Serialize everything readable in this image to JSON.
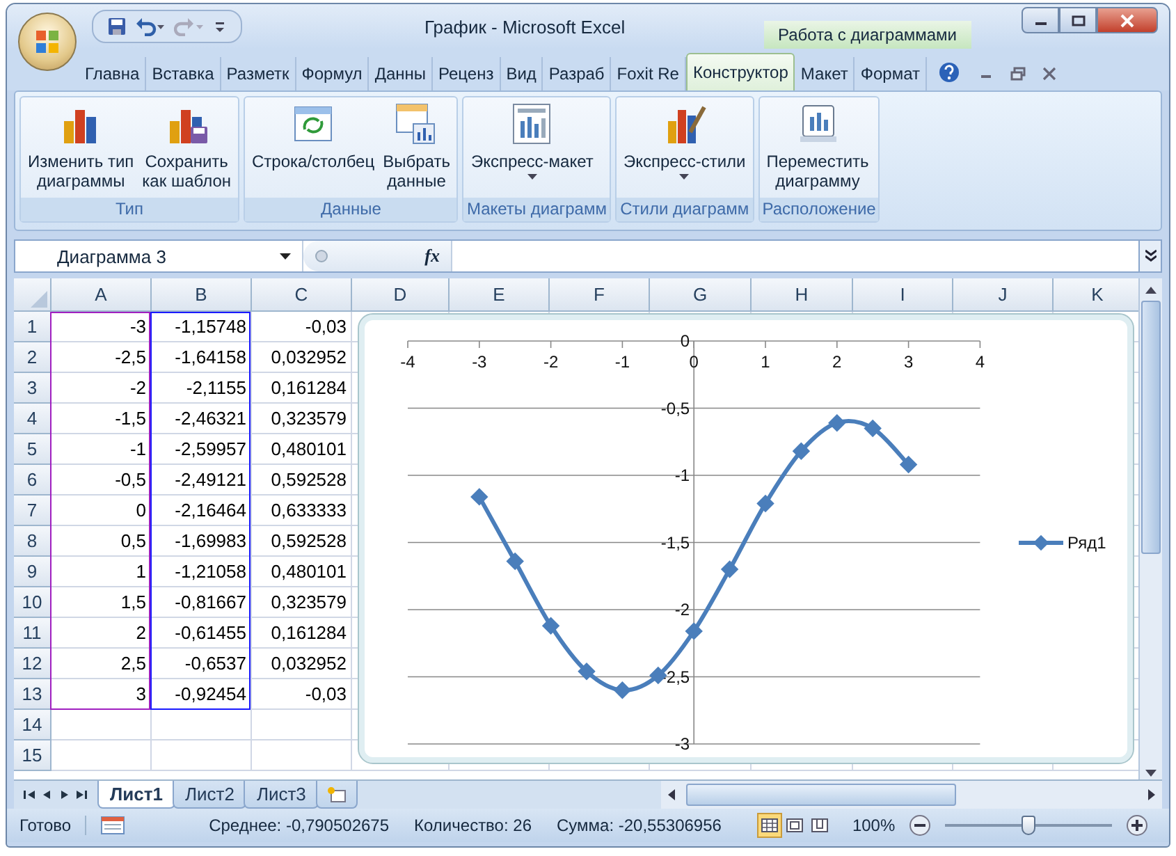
{
  "window": {
    "title": "График - Microsoft Excel",
    "context_title": "Работа с диаграммами"
  },
  "ribbon_tabs": [
    {
      "label": "Главна",
      "selected": false
    },
    {
      "label": "Вставка",
      "selected": false
    },
    {
      "label": "Разметк",
      "selected": false
    },
    {
      "label": "Формул",
      "selected": false
    },
    {
      "label": "Данны",
      "selected": false
    },
    {
      "label": "Реценз",
      "selected": false
    },
    {
      "label": "Вид",
      "selected": false
    },
    {
      "label": "Разраб",
      "selected": false
    },
    {
      "label": "Foxit Re",
      "selected": false
    },
    {
      "label": "Конструктор",
      "selected": true
    },
    {
      "label": "Макет",
      "selected": false
    },
    {
      "label": "Формат",
      "selected": false
    }
  ],
  "ribbon_groups": [
    {
      "label": "Тип",
      "buttons": [
        {
          "label": "Изменить тип\nдиаграммы",
          "kind": "change-type"
        },
        {
          "label": "Сохранить\nкак шаблон",
          "kind": "save-template"
        }
      ]
    },
    {
      "label": "Данные",
      "buttons": [
        {
          "label": "Строка/столбец",
          "kind": "switch"
        },
        {
          "label": "Выбрать\nданные",
          "kind": "select-data"
        }
      ]
    },
    {
      "label": "Макеты диаграмм",
      "buttons": [
        {
          "label": "Экспресс-макет",
          "kind": "layout",
          "dropdown": true
        }
      ]
    },
    {
      "label": "Стили диаграмм",
      "buttons": [
        {
          "label": "Экспресс-стили",
          "kind": "styles",
          "dropdown": true
        }
      ]
    },
    {
      "label": "Расположение",
      "buttons": [
        {
          "label": "Переместить\nдиаграмму",
          "kind": "move"
        }
      ]
    }
  ],
  "formula_bar": {
    "name_box": "Диаграмма 3",
    "fx": "fx"
  },
  "table": {
    "columns": [
      {
        "label": "A",
        "color": "#a020c0"
      },
      {
        "label": "B",
        "color": "#1a1aff"
      },
      {
        "label": "C"
      },
      {
        "label": "D"
      },
      {
        "label": "E"
      },
      {
        "label": "F"
      },
      {
        "label": "G"
      },
      {
        "label": "H"
      },
      {
        "label": "I"
      },
      {
        "label": "J"
      },
      {
        "label": "K"
      }
    ],
    "rows": [
      {
        "header": "1",
        "cells": [
          "-3",
          "-1,15748",
          "-0,03"
        ]
      },
      {
        "header": "2",
        "cells": [
          "-2,5",
          "-1,64158",
          "0,032952"
        ]
      },
      {
        "header": "3",
        "cells": [
          "-2",
          "-2,1155",
          "0,161284"
        ]
      },
      {
        "header": "4",
        "cells": [
          "-1,5",
          "-2,46321",
          "0,323579"
        ]
      },
      {
        "header": "5",
        "cells": [
          "-1",
          "-2,59957",
          "0,480101"
        ]
      },
      {
        "header": "6",
        "cells": [
          "-0,5",
          "-2,49121",
          "0,592528"
        ]
      },
      {
        "header": "7",
        "cells": [
          "0",
          "-2,16464",
          "0,633333"
        ]
      },
      {
        "header": "8",
        "cells": [
          "0,5",
          "-1,69983",
          "0,592528"
        ]
      },
      {
        "header": "9",
        "cells": [
          "1",
          "-1,21058",
          "0,480101"
        ]
      },
      {
        "header": "10",
        "cells": [
          "1,5",
          "-0,81667",
          "0,323579"
        ]
      },
      {
        "header": "11",
        "cells": [
          "2",
          "-0,61455",
          "0,161284"
        ]
      },
      {
        "header": "12",
        "cells": [
          "2,5",
          "-0,6537",
          "0,032952"
        ]
      },
      {
        "header": "13",
        "cells": [
          "3",
          "-0,92454",
          "-0,03"
        ]
      },
      {
        "header": "14"
      },
      {
        "header": "15"
      }
    ]
  },
  "chart": {
    "chart_data": {
      "type": "line",
      "grid": true,
      "x": [
        -3,
        -2.5,
        -2,
        -1.5,
        -1,
        -0.5,
        0,
        0.5,
        1,
        1.5,
        2,
        2.5,
        3
      ],
      "series": [
        {
          "name": "Ряд1",
          "color": "#4a7ebb",
          "marker": "diamond",
          "values": [
            -1.16,
            -1.64,
            -2.12,
            -2.46,
            -2.6,
            -2.49,
            -2.16,
            -1.7,
            -1.21,
            -0.82,
            -0.61,
            -0.65,
            -0.92
          ]
        }
      ],
      "xlim": [
        -4,
        4
      ],
      "ylim": [
        -3,
        0
      ],
      "xticks": [
        -4,
        -3,
        -2,
        -1,
        0,
        1,
        2,
        3,
        4
      ],
      "yticks": [
        0,
        {
          "value": -0.5,
          "label": "-0,5"
        },
        -1,
        {
          "value": -1.5,
          "label": "-1,5"
        },
        -2,
        {
          "value": -2.5,
          "label": "-2,5"
        },
        -3
      ]
    }
  },
  "sheet_tabs": [
    {
      "label": "Лист1",
      "selected": true
    },
    {
      "label": "Лист2",
      "selected": false
    },
    {
      "label": "Лист3",
      "selected": false
    }
  ],
  "status_bar": {
    "mode": "Готово",
    "average": "Среднее: -0,790502675",
    "count": "Количество: 26",
    "sum": "Сумма: -20,55306956",
    "views": [
      {
        "kind": "normal",
        "selected": true
      },
      {
        "kind": "layout",
        "selected": false
      },
      {
        "kind": "pagebreak",
        "selected": false
      }
    ],
    "zoom": "100%",
    "zoom_slider": {
      "level": 0.5
    }
  }
}
